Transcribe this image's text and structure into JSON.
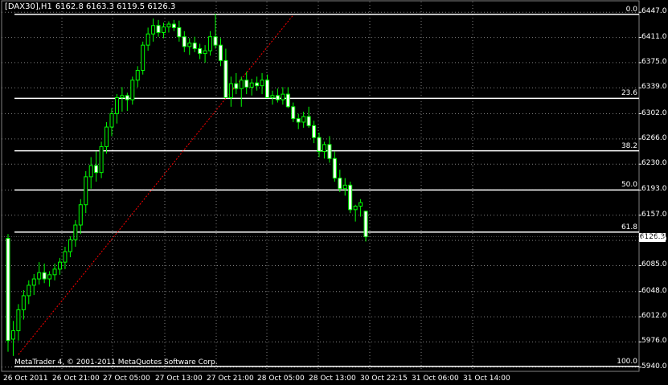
{
  "header": {
    "symbol": "[DAX30],H1",
    "ohlc": "6162.8 6163.3 6119.5 6126.3"
  },
  "copyright": "MetaTrader 4, © 2001-2011 MetaQuotes Software Corp.",
  "current_price": "6126.3",
  "colors": {
    "background": "#000000",
    "grid": "#808080",
    "foreground": "#FFFFFF",
    "bull_candle": "#000000",
    "bear_candle": "#FFFFFF",
    "wick": "#00FF00",
    "fib_trend_line": "#FF0000"
  },
  "chart_data": {
    "type": "candlestick",
    "timeframe": "H1",
    "y_ticks": [
      "6447.0",
      "6411.0",
      "6375.0",
      "6339.0",
      "6302.0",
      "6266.0",
      "6230.0",
      "6193.0",
      "6157.0",
      "6121.0",
      "6085.0",
      "6048.0",
      "6012.0",
      "5976.0",
      "5940.0"
    ],
    "x_ticks": [
      "26 Oct 2011",
      "26 Oct 21:00",
      "27 Oct 05:00",
      "27 Oct 13:00",
      "27 Oct 21:00",
      "28 Oct 05:00",
      "28 Oct 13:00",
      "30 Oct 22:15",
      "31 Oct 06:00",
      "31 Oct 14:00"
    ],
    "ylim": [
      5934,
      6453
    ],
    "fibonacci": {
      "levels": [
        {
          "label": "0.0",
          "price": 6444
        },
        {
          "label": "23.6",
          "price": 6324
        },
        {
          "label": "38.2",
          "price": 6249
        },
        {
          "label": "50.0",
          "price": 6193
        },
        {
          "label": "61.8",
          "price": 6133
        },
        {
          "label": "100.0",
          "price": 5941
        }
      ],
      "trend_from": 5958,
      "trend_to": 6443
    },
    "candles": [
      [
        6124,
        6130,
        5962,
        5978
      ],
      [
        5980,
        6006,
        5956,
        5992
      ],
      [
        5992,
        6030,
        5978,
        6022
      ],
      [
        6022,
        6050,
        6008,
        6042
      ],
      [
        6042,
        6064,
        6030,
        6057
      ],
      [
        6057,
        6073,
        6043,
        6066
      ],
      [
        6066,
        6090,
        6058,
        6075
      ],
      [
        6075,
        6088,
        6060,
        6066
      ],
      [
        6066,
        6077,
        6055,
        6072
      ],
      [
        6072,
        6088,
        6064,
        6080
      ],
      [
        6080,
        6096,
        6072,
        6090
      ],
      [
        6090,
        6112,
        6080,
        6105
      ],
      [
        6105,
        6127,
        6097,
        6122
      ],
      [
        6122,
        6150,
        6112,
        6143
      ],
      [
        6143,
        6180,
        6130,
        6172
      ],
      [
        6172,
        6220,
        6160,
        6212
      ],
      [
        6212,
        6240,
        6195,
        6228
      ],
      [
        6228,
        6248,
        6205,
        6218
      ],
      [
        6218,
        6262,
        6210,
        6255
      ],
      [
        6255,
        6290,
        6245,
        6283
      ],
      [
        6283,
        6310,
        6270,
        6302
      ],
      [
        6302,
        6330,
        6288,
        6325
      ],
      [
        6325,
        6340,
        6305,
        6328
      ],
      [
        6328,
        6332,
        6306,
        6322
      ],
      [
        6322,
        6355,
        6315,
        6350
      ],
      [
        6350,
        6370,
        6340,
        6364
      ],
      [
        6364,
        6405,
        6358,
        6400
      ],
      [
        6400,
        6425,
        6392,
        6416
      ],
      [
        6416,
        6438,
        6405,
        6428
      ],
      [
        6428,
        6436,
        6412,
        6418
      ],
      [
        6418,
        6432,
        6410,
        6426
      ],
      [
        6426,
        6434,
        6418,
        6430
      ],
      [
        6430,
        6436,
        6420,
        6425
      ],
      [
        6425,
        6435,
        6405,
        6412
      ],
      [
        6412,
        6420,
        6390,
        6398
      ],
      [
        6398,
        6410,
        6386,
        6403
      ],
      [
        6403,
        6412,
        6390,
        6395
      ],
      [
        6395,
        6402,
        6380,
        6388
      ],
      [
        6388,
        6400,
        6375,
        6392
      ],
      [
        6392,
        6420,
        6385,
        6412
      ],
      [
        6412,
        6445,
        6395,
        6400
      ],
      [
        6400,
        6410,
        6370,
        6378
      ],
      [
        6378,
        6395,
        6340,
        6325
      ],
      [
        6325,
        6355,
        6312,
        6345
      ],
      [
        6345,
        6360,
        6330,
        6338
      ],
      [
        6338,
        6355,
        6312,
        6350
      ],
      [
        6350,
        6362,
        6330,
        6340
      ],
      [
        6340,
        6352,
        6328,
        6346
      ],
      [
        6346,
        6355,
        6335,
        6342
      ],
      [
        6342,
        6360,
        6330,
        6350
      ],
      [
        6350,
        6358,
        6330,
        6325
      ],
      [
        6325,
        6335,
        6315,
        6328
      ],
      [
        6328,
        6338,
        6318,
        6322
      ],
      [
        6322,
        6340,
        6315,
        6330
      ],
      [
        6330,
        6340,
        6310,
        6312
      ],
      [
        6312,
        6318,
        6290,
        6295
      ],
      [
        6295,
        6302,
        6280,
        6290
      ],
      [
        6290,
        6305,
        6282,
        6298
      ],
      [
        6298,
        6312,
        6282,
        6285
      ],
      [
        6285,
        6292,
        6260,
        6268
      ],
      [
        6268,
        6275,
        6240,
        6248
      ],
      [
        6248,
        6262,
        6238,
        6258
      ],
      [
        6258,
        6270,
        6232,
        6238
      ],
      [
        6238,
        6248,
        6205,
        6210
      ],
      [
        6210,
        6222,
        6190,
        6195
      ],
      [
        6195,
        6210,
        6185,
        6200
      ],
      [
        6200,
        6205,
        6160,
        6165
      ],
      [
        6165,
        6172,
        6148,
        6170
      ],
      [
        6170,
        6180,
        6155,
        6175
      ],
      [
        6162.8,
        6163.3,
        6119.5,
        6126.3
      ]
    ]
  }
}
